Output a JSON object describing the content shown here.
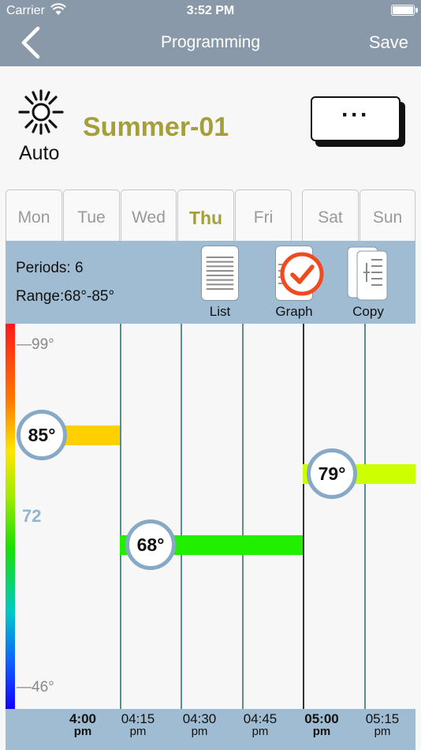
{
  "status_bar": {
    "carrier": "Carrier",
    "time": "3:52 PM"
  },
  "nav": {
    "title": "Programming",
    "save_label": "Save"
  },
  "header": {
    "mode_label": "Auto",
    "program_name": "Summer-01",
    "more_label": "···"
  },
  "days": [
    {
      "label": "Mon",
      "active": false
    },
    {
      "label": "Tue",
      "active": false
    },
    {
      "label": "Wed",
      "active": false
    },
    {
      "label": "Thu",
      "active": true
    },
    {
      "label": "Fri",
      "active": false
    },
    {
      "label": "Sat",
      "active": false
    },
    {
      "label": "Sun",
      "active": false
    }
  ],
  "info": {
    "periods": "Periods: 6",
    "range": "Range:68°-85°",
    "tools": {
      "list": "List",
      "graph": "Graph",
      "copy": "Copy"
    }
  },
  "graph": {
    "scale_max": "—99°",
    "scale_mid": "72",
    "scale_min": "—46°",
    "setpoints": [
      {
        "label": "85°",
        "temp": 85,
        "color": "#ffd000"
      },
      {
        "label": "68°",
        "temp": 68,
        "color": "#22ee00"
      },
      {
        "label": "79°",
        "temp": 79,
        "color": "#ccff00"
      }
    ]
  },
  "time_axis": [
    {
      "time": "4:00",
      "ampm": "pm",
      "bold": true
    },
    {
      "time": "04:15",
      "ampm": "pm",
      "bold": false
    },
    {
      "time": "04:30",
      "ampm": "pm",
      "bold": false
    },
    {
      "time": "04:45",
      "ampm": "pm",
      "bold": false
    },
    {
      "time": "05:00",
      "ampm": "pm",
      "bold": true
    },
    {
      "time": "05:15",
      "ampm": "pm",
      "bold": false
    }
  ],
  "colors": {
    "accent": "#a59f3a",
    "nav_bg": "#8a99a9",
    "band_bg": "#9fbcd2",
    "check": "#f04a1e"
  },
  "icons": [
    "back-chevron-icon",
    "wifi-icon",
    "battery-icon",
    "sun-icon",
    "list-icon",
    "graph-check-icon",
    "copy-icon"
  ]
}
